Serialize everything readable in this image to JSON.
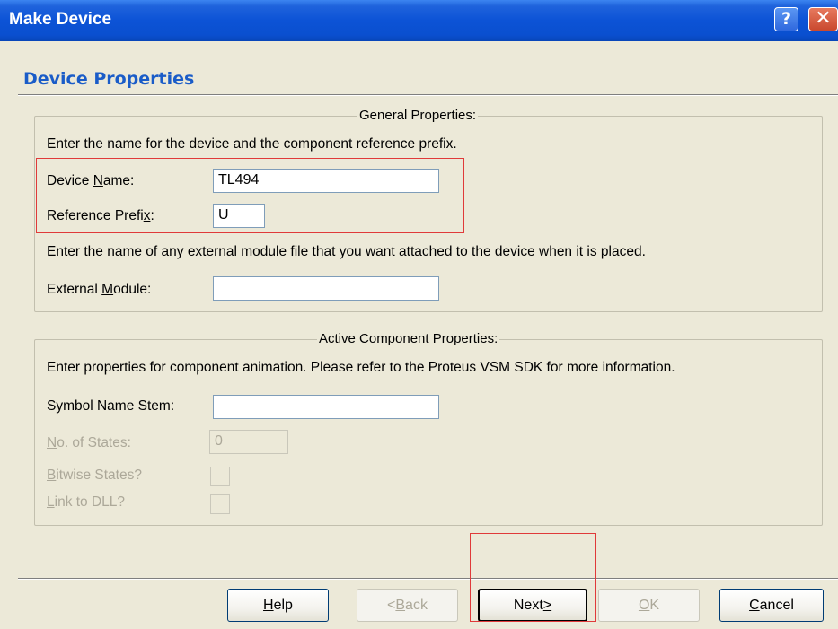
{
  "window": {
    "title": "Make Device",
    "help_glyph": "?",
    "close_glyph": "✕"
  },
  "page_heading": "Device Properties",
  "general": {
    "group_title": "General Properties:",
    "intro": "Enter the name for the device and the component reference prefix.",
    "device_name": {
      "label_pre": "Device ",
      "label_key": "N",
      "label_post": "ame:",
      "value": "TL494"
    },
    "reference_prefix": {
      "label_pre": "Reference Prefi",
      "label_key": "x",
      "label_post": ":",
      "value": "U"
    },
    "module_intro": "Enter the name of any external module file that you want attached to the device when it is placed.",
    "external_module": {
      "label_pre": "External ",
      "label_key": "M",
      "label_post": "odule:",
      "value": ""
    }
  },
  "active": {
    "group_title": "Active Component Properties:",
    "intro": "Enter properties for component animation. Please refer to the Proteus VSM SDK for more information.",
    "symbol_stem": {
      "label": "Symbol Name Stem:",
      "value": ""
    },
    "states": {
      "label_key": "N",
      "label_post": "o. of States:",
      "value": "0"
    },
    "bitwise": {
      "label_key": "B",
      "label_post": "itwise States?",
      "checked": false
    },
    "dll": {
      "label_key": "L",
      "label_post": "ink to DLL?",
      "checked": false
    }
  },
  "buttons": {
    "help": {
      "key": "H",
      "rest": "elp"
    },
    "back": {
      "pre": "<",
      "key": "B",
      "rest": "ack"
    },
    "next": {
      "pre": "Next",
      "key": ">"
    },
    "ok": {
      "key": "O",
      "rest": "K"
    },
    "cancel": {
      "key": "C",
      "rest": "ancel"
    }
  },
  "colors": {
    "title_bar": "#0a4fcf",
    "heading": "#1a5cc8",
    "dialog_bg": "#ece9d8",
    "highlight_box": "#e03a3a"
  }
}
